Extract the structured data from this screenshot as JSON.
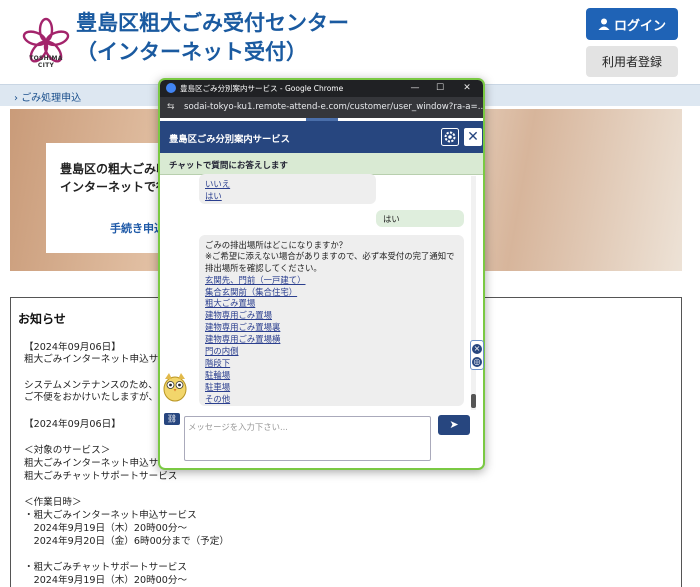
{
  "header": {
    "logo_text": "TOSHIMA CITY",
    "title_line1": "豊島区粗大ごみ受付センター",
    "title_line2": "（インターネット受付）",
    "login_label": "ログイン",
    "register_label": "利用者登録"
  },
  "breadcrumb": {
    "label": "ごみ処理申込"
  },
  "hero": {
    "line1": "豊島区の粗大ごみ収",
    "line2": "インターネットで行う",
    "link": "手続き申込"
  },
  "notice": {
    "title": "お知らせ",
    "lines": [
      "【2024年09月06日】",
      "粗大ごみインターネット申込サー",
      "システムメンテナンスのため、下",
      "ご不便をおかけいたしますが、何",
      "【2024年09月06日】",
      "＜対象のサービス＞",
      "粗大ごみインターネット申込サー",
      "粗大ごみチャットサポートサービス",
      "＜作業日時＞",
      "・粗大ごみインターネット申込サービス",
      "　2024年9月19日（木）20時00分～",
      "　2024年9月20日（金）6時00分まで（予定）",
      "・粗大ごみチャットサポートサービス",
      "　2024年9月19日（木）20時00分～"
    ]
  },
  "chrome": {
    "window_title": "豊島区ごみ分別案内サービス - Google Chrome",
    "url": "sodai-tokyo-ku1.remote-attend-e.com/customer/user_window?ra-a=..."
  },
  "chat": {
    "title": "豊島区ごみ分別案内サービス",
    "subtitle": "チャットで質問にお答えします",
    "prev_options": [
      "いいえ",
      "はい"
    ],
    "user_reply": "はい",
    "question_lines": [
      "ごみの排出場所はどこになりますか？",
      "※ご希望に添えない場合がありますので、必ず本受付の完了通知で",
      "排出場所を確認してください。"
    ],
    "options": [
      "玄関先、門前（一戸建て）",
      "集合玄関前（集合住宅）",
      "粗大ごみ置場",
      "建物専用ごみ置場",
      "建物専用ごみ置場裏",
      "建物専用ごみ置場横",
      "門の内側",
      "階段下",
      "駐輪場",
      "駐車場",
      "その他"
    ],
    "input_placeholder": "メッセージを入力下さい..."
  },
  "colors": {
    "brand_blue": "#1a5aa0",
    "chat_navy": "#27467f",
    "chat_green": "#d9ead3",
    "window_border": "#7ac943"
  }
}
